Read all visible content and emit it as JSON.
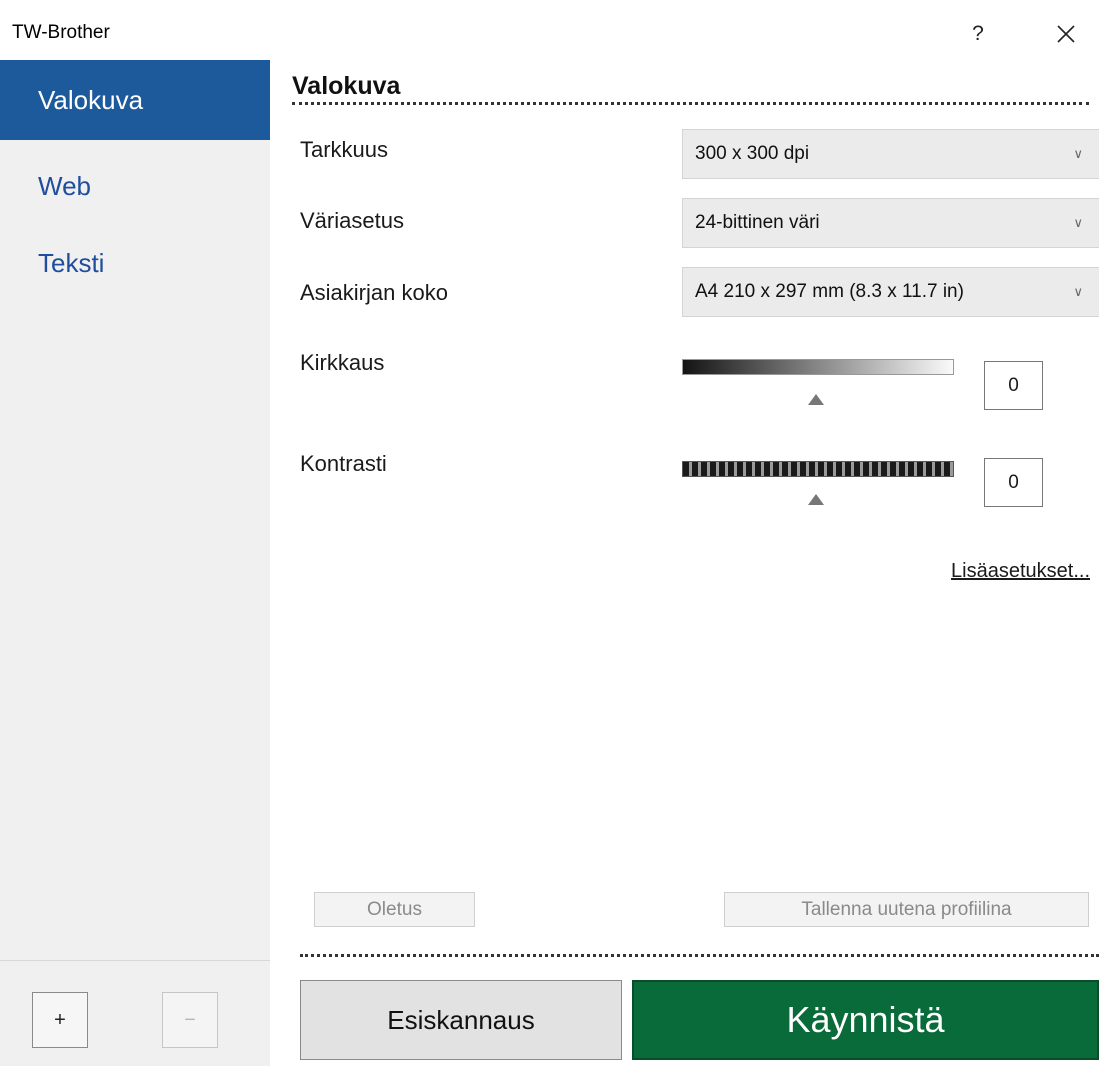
{
  "window": {
    "title": "TW-Brother",
    "help_label": "?",
    "close_icon": "close-icon"
  },
  "sidebar": {
    "items": [
      {
        "label": "Valokuva",
        "active": true
      },
      {
        "label": "Web",
        "active": false
      },
      {
        "label": "Teksti",
        "active": false
      }
    ],
    "add_label": "+",
    "remove_label": "−"
  },
  "main": {
    "section_title": "Valokuva",
    "resolution": {
      "label": "Tarkkuus",
      "value": "300 x 300 dpi"
    },
    "color": {
      "label": "Väriasetus",
      "value": "24-bittinen väri"
    },
    "doc_size": {
      "label": "Asiakirjan koko",
      "value": "A4 210 x 297 mm (8.3 x 11.7 in)"
    },
    "brightness": {
      "label": "Kirkkaus",
      "value": "0"
    },
    "contrast": {
      "label": "Kontrasti",
      "value": "0"
    },
    "advanced_link": "Lisäasetukset...",
    "default_button": "Oletus",
    "save_profile_button": "Tallenna uutena profiilina",
    "prescan_button": "Esiskannaus",
    "start_button": "Käynnistä",
    "start_color": "#0a6b3a",
    "accent_color": "#1d5a9c"
  }
}
